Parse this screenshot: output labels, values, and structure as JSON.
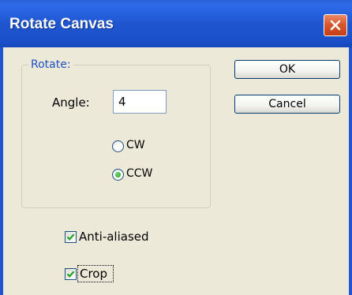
{
  "window": {
    "title": "Rotate Canvas"
  },
  "icons": {
    "close": "close-icon",
    "check": "check-icon"
  },
  "colors": {
    "titlebar": "#1f56cf",
    "close_button": "#d9582f",
    "group_label": "#1f50c4",
    "face": "#ece9d8"
  },
  "rotate_group": {
    "label": "Rotate:",
    "angle_label": "Angle:",
    "angle_value": "4",
    "direction_options": [
      {
        "label": "CW",
        "selected": false
      },
      {
        "label": "CCW",
        "selected": true
      }
    ]
  },
  "options": {
    "anti_aliased": {
      "label": "Anti-aliased",
      "checked": true
    },
    "crop": {
      "label": "Crop",
      "checked": true
    }
  },
  "buttons": {
    "ok": "OK",
    "cancel": "Cancel"
  }
}
